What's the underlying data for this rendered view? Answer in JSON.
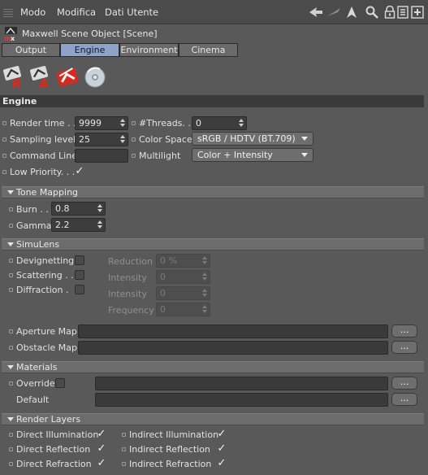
{
  "menubar": {
    "items": [
      "Modo",
      "Modifica",
      "Dati Utente"
    ],
    "tools": [
      "arrow-left-icon",
      "arrow-slant-icon",
      "arrow-up-icon",
      "search-icon",
      "lock-icon",
      "settings-icon",
      "add-icon"
    ]
  },
  "object": {
    "title": "Maxwell Scene Object [Scene]"
  },
  "tabs": [
    {
      "label": "Output",
      "active": false
    },
    {
      "label": "Engine",
      "active": true
    },
    {
      "label": "Environment",
      "active": false
    },
    {
      "label": "Cinema",
      "active": false
    }
  ],
  "engine": {
    "section_title": "Engine",
    "render_time_label": "Render time . .",
    "render_time_value": "9999",
    "threads_label": "#Threads. .",
    "threads_value": "0",
    "sampling_label": "Sampling level",
    "sampling_value": "25",
    "color_space_label": "Color Space",
    "color_space_value": "sRGB / HDTV (BT.709)",
    "command_line_label": "Command Line",
    "command_line_value": "",
    "multilight_label": "Multilight",
    "multilight_value": "Color + Intensity",
    "low_priority_label": "Low Priority. . .",
    "low_priority_checked": true
  },
  "tone_mapping": {
    "title": "Tone Mapping",
    "burn_label": "Burn . .",
    "burn_value": "0.8",
    "gamma_label": "Gamma",
    "gamma_value": "2.2"
  },
  "simulens": {
    "title": "SimuLens",
    "devignetting_label": "Devignetting",
    "scattering_label": "Scattering . .",
    "diffraction_label": "Diffraction .",
    "reduction_label": "Reduction",
    "reduction_value": "0 %",
    "intensity1_label": "Intensity",
    "intensity1_value": "0",
    "intensity2_label": "Intensity",
    "intensity2_value": "0",
    "frequency_label": "Frequency",
    "frequency_value": "0",
    "aperture_label": "Aperture Map",
    "obstacle_label": "Obstacle Map",
    "browse_label": "..."
  },
  "materials": {
    "title": "Materials",
    "override_label": "Override",
    "default_label": "Default",
    "browse_label": "..."
  },
  "render_layers": {
    "title": "Render Layers",
    "direct_illumination": "Direct Illumination",
    "indirect_illumination": "Indirect Illumination",
    "direct_reflection": "Direct Reflection",
    "indirect_reflection": "Indirect Reflection",
    "direct_refraction": "Direct Refraction",
    "indirect_refraction": "Indirect Refraction",
    "checkmark": "✓"
  },
  "colors": {
    "panel_bg": "#595959",
    "active_tab": "#8ea3c7",
    "field_bg": "#3d3d3d"
  }
}
